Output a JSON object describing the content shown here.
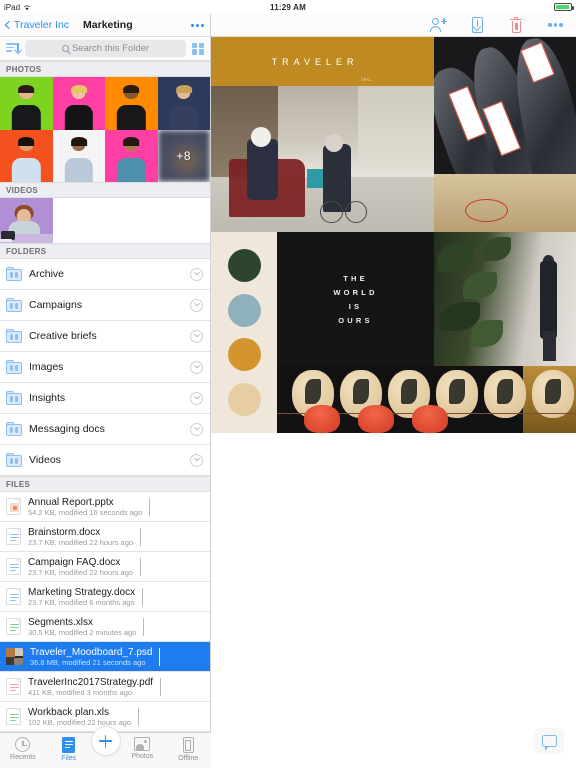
{
  "status_bar": {
    "device": "iPad",
    "time": "11:29 AM",
    "wifi_icon": "wifi-icon",
    "battery_icon": "battery-icon"
  },
  "nav": {
    "back_label": "Traveler Inc",
    "title": "Marketing",
    "more_icon": "more-horizontal-icon",
    "back_icon": "chevron-left-icon"
  },
  "search": {
    "placeholder": "Search this Folder",
    "value": "",
    "sort_icon": "sort-icon",
    "search_icon": "search-icon",
    "grid_icon": "grid-view-icon"
  },
  "sections": {
    "photos": "PHOTOS",
    "videos": "VIDEOS",
    "folders": "FOLDERS",
    "files": "FILES"
  },
  "photos": {
    "overflow_label": "+8",
    "tiles": [
      {
        "bg": "#7ed321",
        "skin": "#e8b48f",
        "hair": "#2a1d17",
        "shirt": "#17181c"
      },
      {
        "bg": "#ff3fa4",
        "skin": "#f0c3a3",
        "hair": "#e8c56a",
        "shirt": "#141414"
      },
      {
        "bg": "#ff8a00",
        "skin": "#8a5733",
        "hair": "#2b1b10",
        "shirt": "#18181a"
      },
      {
        "bg": "#2e3a5c",
        "skin": "#e4b994",
        "hair": "#c8a05c",
        "shirt": "#353f5e"
      },
      {
        "bg": "#f4511e",
        "skin": "#d8a271",
        "hair": "#17120e",
        "shirt": "#cfe0ef"
      },
      {
        "bg": "#f4f4f4",
        "skin": "#9a6b45",
        "hair": "#1d1510",
        "shirt": "#b9c9d8"
      },
      {
        "bg": "#ff3fa4",
        "skin": "#b07a50",
        "hair": "#241812",
        "shirt": "#4e8fae"
      },
      {
        "bg": "#3c4357",
        "skin": "#3c4357",
        "hair": "#3c4357",
        "shirt": "#3c4357"
      }
    ]
  },
  "videos": {
    "count": 1
  },
  "folders": [
    {
      "name": "Archive",
      "icon": "folder-icon",
      "chevron": "chevron-down-icon"
    },
    {
      "name": "Campaigns",
      "icon": "folder-icon",
      "chevron": "chevron-down-icon"
    },
    {
      "name": "Creative briefs",
      "icon": "folder-icon",
      "chevron": "chevron-down-icon"
    },
    {
      "name": "Images",
      "icon": "folder-icon",
      "chevron": "chevron-down-icon"
    },
    {
      "name": "Insights",
      "icon": "folder-icon",
      "chevron": "chevron-down-icon"
    },
    {
      "name": "Messaging docs",
      "icon": "folder-icon",
      "chevron": "chevron-down-icon"
    },
    {
      "name": "Videos",
      "icon": "folder-icon",
      "chevron": "chevron-down-icon"
    }
  ],
  "files": [
    {
      "name": "Annual Report.pptx",
      "meta": "54.2 KB, modified 16 seconds ago",
      "kind": "pptx",
      "selected": false
    },
    {
      "name": "Brainstorm.docx",
      "meta": "23.7 KB, modified 22 hours ago",
      "kind": "docx",
      "selected": false
    },
    {
      "name": "Campaign FAQ.docx",
      "meta": "23.7 KB, modified 22 hours ago",
      "kind": "docx",
      "selected": false
    },
    {
      "name": "Marketing Strategy.docx",
      "meta": "23.7 KB, modified 6 months ago",
      "kind": "docx",
      "selected": false
    },
    {
      "name": "Segments.xlsx",
      "meta": "30.5 KB, modified 2 minutes ago",
      "kind": "xlsx",
      "selected": false
    },
    {
      "name": "Traveler_Moodboard_7.psd",
      "meta": "36.8 MB, modified 21 seconds ago",
      "kind": "psd",
      "selected": true
    },
    {
      "name": "TravelerInc2017Strategy.pdf",
      "meta": "411 KB, modified 3 months ago",
      "kind": "pdf",
      "selected": false
    },
    {
      "name": "Workback plan.xls",
      "meta": "102 KB, modified 22 hours ago",
      "kind": "xls",
      "selected": false
    }
  ],
  "preview_toolbar": {
    "share_icon": "add-person-icon",
    "download_icon": "download-to-device-icon",
    "delete_icon": "trash-icon",
    "more_icon": "more-horizontal-icon"
  },
  "moodboard": {
    "brand_name": "TRAVELER",
    "brand_suffix": "inc.",
    "quote_lines": [
      "THE",
      "WORLD",
      "IS",
      "OURS"
    ],
    "swatches": [
      "#2d4430",
      "#8fb0bd",
      "#d4942e",
      "#e6cda4"
    ],
    "banner_color": "#c08a22"
  },
  "chat": {
    "icon": "chat-bubble-icon"
  },
  "tabbar": {
    "items": [
      {
        "label": "Recents",
        "icon": "clock-icon",
        "active": false
      },
      {
        "label": "Files",
        "icon": "files-icon",
        "active": true
      },
      {
        "label": "Photos",
        "icon": "photos-icon",
        "active": false
      },
      {
        "label": "Offline",
        "icon": "offline-device-icon",
        "active": false
      }
    ],
    "add_label": "+",
    "add_icon": "plus-icon"
  }
}
